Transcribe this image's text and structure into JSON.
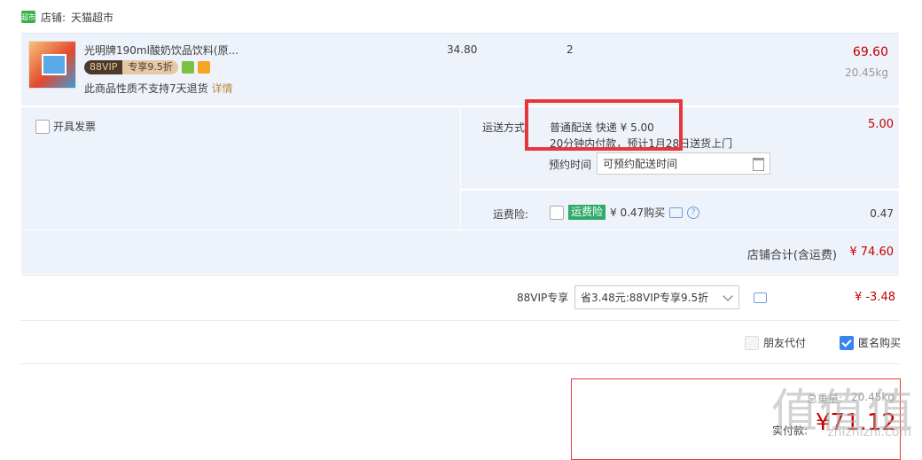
{
  "store": {
    "logo_text": "超市",
    "label": "店铺:",
    "name": "天猫超市"
  },
  "item": {
    "title": "光明牌190ml酸奶饮品饮料(原...",
    "vip_tag": "88VIP",
    "vip_discount": "专享9.5折",
    "return_notice": "此商品性质不支持7天退货",
    "details_link": "详情",
    "price": "34.80",
    "quantity": "2",
    "subtotal": "69.60",
    "weight": "20.45kg"
  },
  "invoice": {
    "label": "开具发票"
  },
  "shipping": {
    "label": "运送方式:",
    "method": "普通配送 快递 ¥ 5.00",
    "note": "20分钟内付款，预计1月28日送货上门",
    "fee": "5.00",
    "schedule_label": "预约时间",
    "schedule_placeholder": "可预约配送时间"
  },
  "insurance": {
    "label": "运费险:",
    "tag": "运费险",
    "price_text": "¥ 0.47购买",
    "fee": "0.47"
  },
  "store_total": {
    "label": "店铺合计(含运费)",
    "value": "¥ 74.60"
  },
  "vip_discount": {
    "label": "88VIP专享",
    "selected": "省3.48元:88VIP专享9.5折",
    "value": "¥ -3.48"
  },
  "options": {
    "friend_pay": "朋友代付",
    "anonymous": "匿名购买"
  },
  "payment": {
    "weight_label": "总重量:",
    "weight_value": "20.45kg",
    "pay_label": "实付款:",
    "pay_value": "¥71.12"
  },
  "watermark": {
    "big": "值值值",
    "small": "zhizhizhi.com"
  },
  "colors": {
    "accent": "#c40000",
    "highlight_box": "#e8373a",
    "panel_bg": "#eef3fb"
  }
}
